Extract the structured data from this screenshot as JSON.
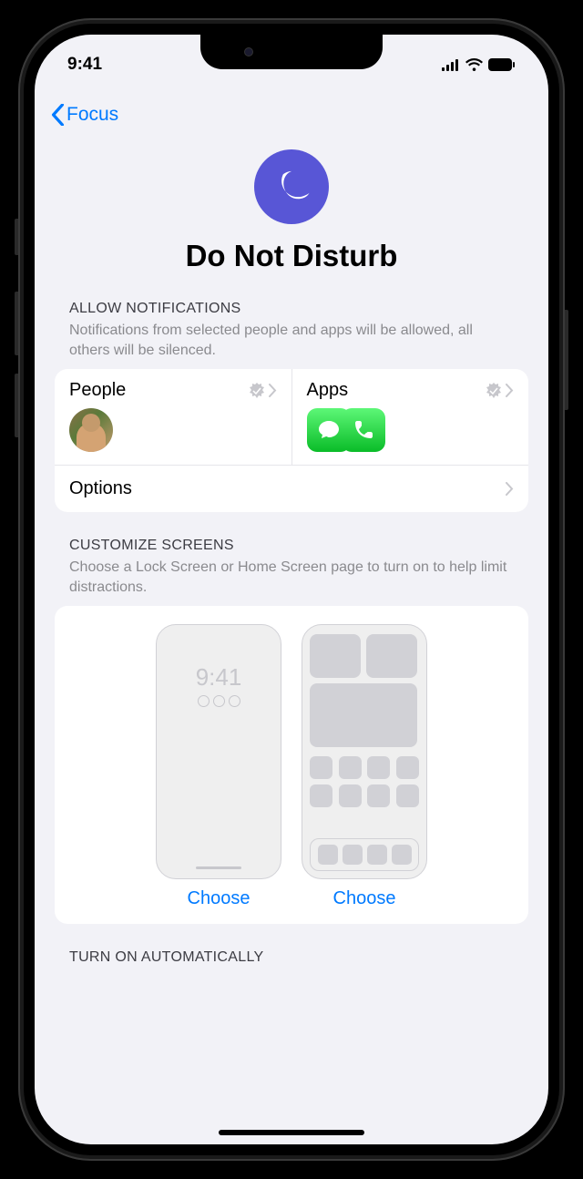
{
  "status": {
    "time": "9:41"
  },
  "nav": {
    "back": "Focus"
  },
  "hero": {
    "title": "Do Not Disturb"
  },
  "notifications": {
    "header": "ALLOW NOTIFICATIONS",
    "desc": "Notifications from selected people and apps will be allowed, all others will be silenced.",
    "people": {
      "label": "People"
    },
    "apps": {
      "label": "Apps"
    },
    "options": {
      "label": "Options"
    }
  },
  "screens": {
    "header": "CUSTOMIZE SCREENS",
    "desc": "Choose a Lock Screen or Home Screen page to turn on to help limit distractions.",
    "lock_time": "9:41",
    "choose_lock": "Choose",
    "choose_home": "Choose"
  },
  "automatic": {
    "header": "TURN ON AUTOMATICALLY"
  }
}
